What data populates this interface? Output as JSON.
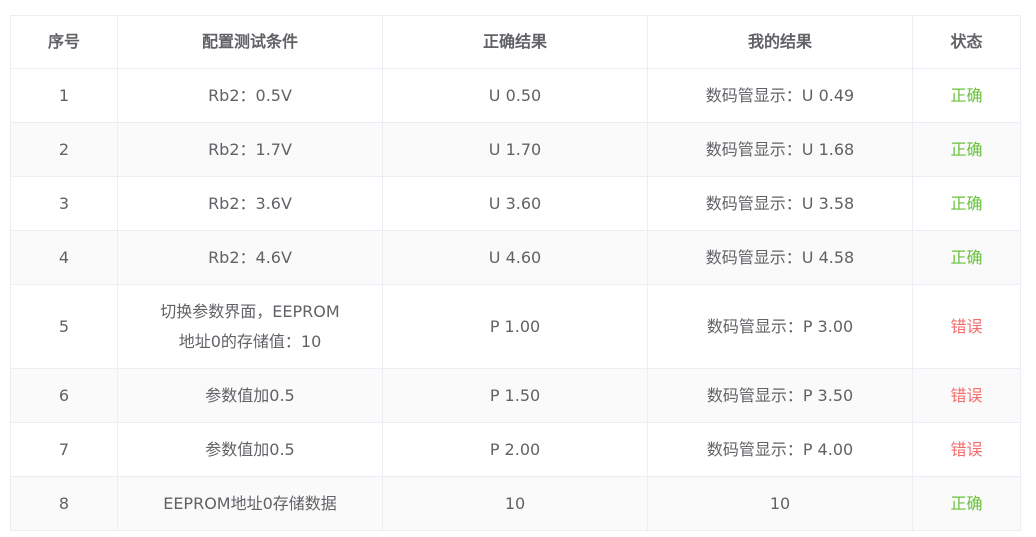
{
  "table": {
    "headers": [
      "序号",
      "配置测试条件",
      "正确结果",
      "我的结果",
      "状态"
    ],
    "rows": [
      {
        "no": "1",
        "condition": [
          "Rb2：0.5V"
        ],
        "expected": "U 0.50",
        "actual": "数码管显示：U 0.49",
        "status": "正确",
        "ok": true
      },
      {
        "no": "2",
        "condition": [
          "Rb2：1.7V"
        ],
        "expected": "U 1.70",
        "actual": "数码管显示：U 1.68",
        "status": "正确",
        "ok": true
      },
      {
        "no": "3",
        "condition": [
          "Rb2：3.6V"
        ],
        "expected": "U 3.60",
        "actual": "数码管显示：U 3.58",
        "status": "正确",
        "ok": true
      },
      {
        "no": "4",
        "condition": [
          "Rb2：4.6V"
        ],
        "expected": "U 4.60",
        "actual": "数码管显示：U 4.58",
        "status": "正确",
        "ok": true
      },
      {
        "no": "5",
        "condition": [
          "切换参数界面，EEPROM",
          "地址0的存储值：10"
        ],
        "expected": "P 1.00",
        "actual": "数码管显示：P 3.00",
        "status": "错误",
        "ok": false
      },
      {
        "no": "6",
        "condition": [
          "参数值加0.5"
        ],
        "expected": "P 1.50",
        "actual": "数码管显示：P 3.50",
        "status": "错误",
        "ok": false
      },
      {
        "no": "7",
        "condition": [
          "参数值加0.5"
        ],
        "expected": "P 2.00",
        "actual": "数码管显示：P 4.00",
        "status": "错误",
        "ok": false
      },
      {
        "no": "8",
        "condition": [
          "EEPROM地址0存储数据"
        ],
        "expected": "10",
        "actual": "10",
        "status": "正确",
        "ok": true
      }
    ]
  },
  "colors": {
    "ok": "#67c23a",
    "error": "#f56c6c",
    "text": "#606266",
    "border": "#ebeef5",
    "stripe": "#fafafa"
  }
}
